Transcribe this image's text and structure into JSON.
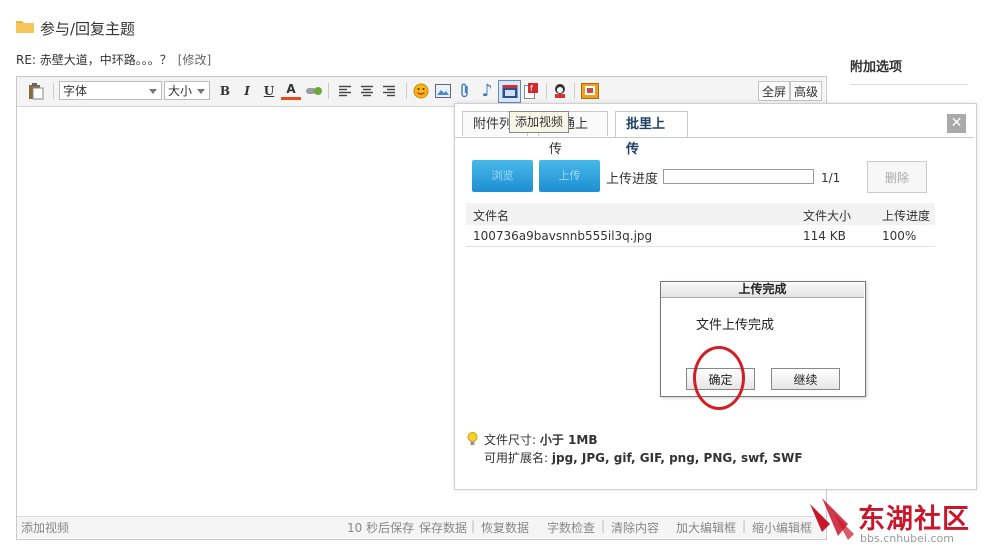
{
  "page": {
    "title": "参与/回复主题",
    "subject": "RE: 赤壁大道，中环路。。。？",
    "edit_link": "[修改]"
  },
  "options": {
    "title": "附加选项"
  },
  "toolbar": {
    "font_label": "字体",
    "size_label": "大小",
    "bold": "B",
    "italic": "I",
    "underline": "U",
    "fontcolor": "A",
    "fullscreen": "全屏",
    "advanced": "高级",
    "icons": [
      "paste-icon",
      "bold-icon",
      "italic-icon",
      "underline-icon",
      "font-color-icon",
      "link-icon",
      "align-left-icon",
      "align-center-icon",
      "align-right-icon",
      "emoticon-icon",
      "image-icon",
      "attachment-icon",
      "music-icon",
      "video-icon",
      "flash-icon",
      "user-icon",
      "quote-icon"
    ]
  },
  "tooltip": "添加视频",
  "statusbar": {
    "left": "添加视频",
    "autosave": "10 秒后保存",
    "save": "保存数据",
    "restore": "恢复数据",
    "wordcount": "字数检查",
    "clear": "清除内容",
    "enlarge": "加大编辑框",
    "shrink": "缩小编辑框"
  },
  "upload": {
    "tabs": [
      "附件列",
      "普通上传",
      "批里上传"
    ],
    "browse_label": "浏览",
    "upload_label": "上传",
    "progress_label": "上传进度",
    "progress_fraction": 0,
    "count": "1/1",
    "delete_label": "删除",
    "columns": [
      "文件名",
      "文件大小",
      "上传进度"
    ],
    "rows": [
      {
        "name": "100736a9bavsnnb555il3q.jpg",
        "size": "114 KB",
        "progress": "100%"
      }
    ],
    "tip_size_label": "文件尺寸:",
    "tip_size_value": "小于  1MB",
    "tip_ext_label": "可用扩展名:",
    "tip_ext_value": "jpg, JPG, gif, GIF, png, PNG, swf, SWF"
  },
  "dialog": {
    "title": "上传完成",
    "message": "文件上传完成",
    "ok": "确定",
    "continue": "继续"
  },
  "watermark": {
    "text": "东湖社区",
    "url": "bbs.cnhubei.com"
  },
  "colors": {
    "accent_blue": "#1d8fd1",
    "highlight_red": "#d21f26",
    "watermark_red": "#c8162b"
  }
}
